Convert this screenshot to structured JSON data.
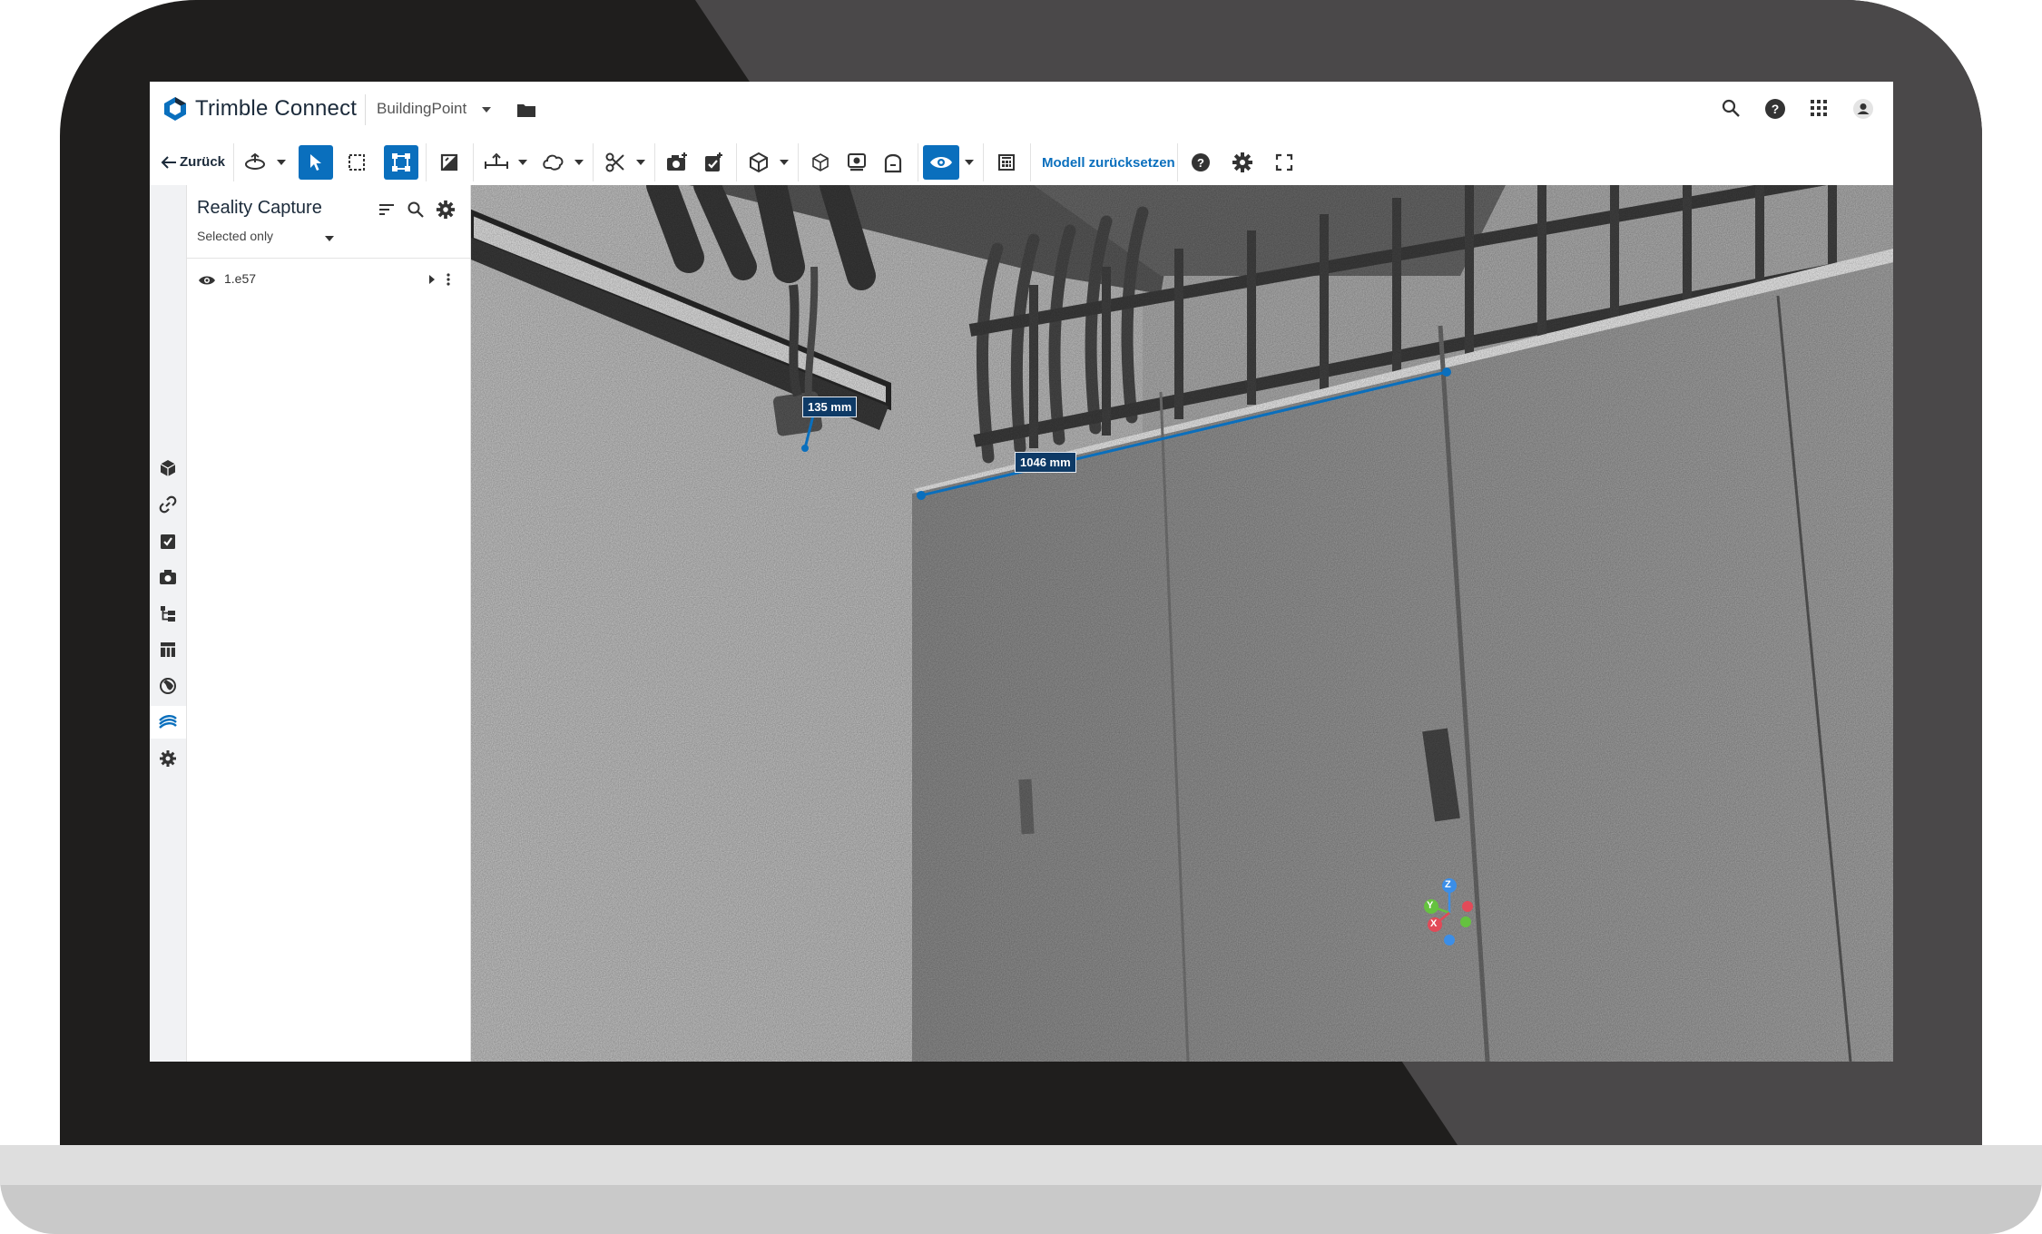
{
  "header": {
    "brand": "Trimble Connect",
    "project": "BuildingPoint",
    "icons": [
      "search-icon",
      "help-icon",
      "apps-grid-icon",
      "user-avatar-icon"
    ]
  },
  "toolbar": {
    "back_label": "Zurück",
    "reset_label": "Modell zurücksetzen",
    "accent_color": "#0a6fbd"
  },
  "rail": {
    "items": [
      "models-icon",
      "link-icon",
      "todo-icon",
      "camera-icon",
      "tree-icon",
      "table-icon",
      "globe-icon",
      "reality-capture-icon",
      "extensions-icon"
    ],
    "active_index": 7
  },
  "panel": {
    "title": "Reality Capture",
    "filter": "Selected only",
    "files": [
      {
        "name": "1.e57"
      }
    ]
  },
  "viewport": {
    "measurements": [
      "135 mm",
      "1046 mm"
    ],
    "axes": {
      "x": "X",
      "y": "Y",
      "z": "Z"
    }
  }
}
